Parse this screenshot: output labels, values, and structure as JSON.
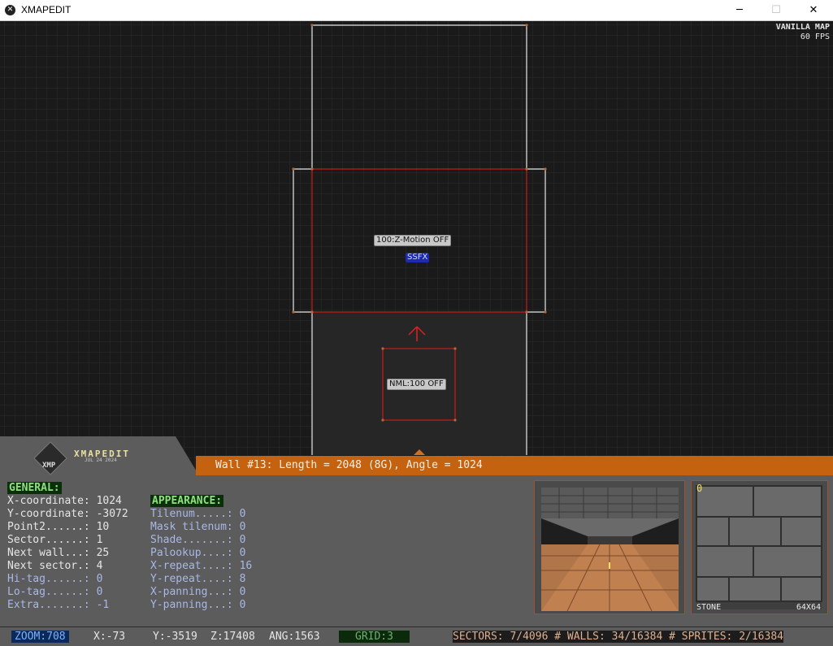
{
  "window": {
    "title": "XMAPEDIT",
    "minimize": "─",
    "maximize": "☐",
    "close": "✕"
  },
  "hud": {
    "map_name": "VANILLA MAP",
    "fps": "60 FPS"
  },
  "map_labels": {
    "sector_effect": "100:Z-Motion OFF",
    "sprite_ssfx": "SSFX",
    "sprite_nml": "NML:100 OFF"
  },
  "logo": {
    "name": "XMAPEDIT",
    "date": "JUL 24 2024",
    "badge": "XMP"
  },
  "info_bar": {
    "text": "Wall #13: Length = 2048 (8G), Angle = 1024"
  },
  "general": {
    "header": "GENERAL:",
    "rows": [
      "X-coordinate: 1024",
      "Y-coordinate: -3072",
      "Point2......: 10",
      "Sector......: 1",
      "Next wall...: 25",
      "Next sector.: 4",
      "Hi-tag......: 0",
      "Lo-tag......: 0",
      "Extra.......: -1"
    ]
  },
  "appearance": {
    "header": "APPEARANCE:",
    "rows": [
      "Tilenum.....: 0",
      "Mask tilenum: 0",
      "Shade.......: 0",
      "Palookup....: 0",
      "X-repeat....: 16",
      "Y-repeat....: 8",
      "X-panning...: 0",
      "Y-panning...: 0"
    ]
  },
  "texture": {
    "index": "0",
    "name": "STONE",
    "size": "64X64"
  },
  "status": {
    "zoom": "ZOOM:708",
    "x": "X:-73",
    "y": "Y:-3519",
    "z": "Z:17408",
    "ang": "ANG:1563",
    "grid": "GRID:3",
    "stats": "SECTORS: 7/4096 # WALLS: 34/16384 # SPRITES: 2/16384"
  },
  "colors": {
    "bg": "#1a1a1a",
    "grid": "#2c2c2c",
    "orange": "#c4620f",
    "panel": "#5c5c5c",
    "red_wall": "#d01818",
    "white_wall": "#e8e8e8"
  }
}
